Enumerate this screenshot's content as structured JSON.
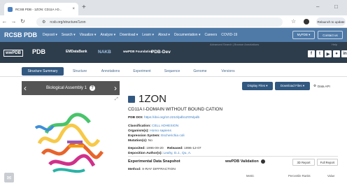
{
  "browser": {
    "tab_title": "RCSB PDB - 1ZON: CD11A I-D...",
    "tab_close": "×",
    "new_tab": "+",
    "url": "rcsb.org/structure/1zon",
    "update_label": "Relaunch to update",
    "minimize": "–",
    "maximize": "□"
  },
  "rcsb_nav": {
    "brand": "RCSB PDB",
    "items": [
      "Deposit ▾",
      "Search ▾",
      "Visualize ▾",
      "Analyze ▾",
      "Download ▾",
      "Learn ▾",
      "About ▾",
      "Documentation ▾",
      "Careers",
      "COVID-19"
    ],
    "mypdb": "MyPDB ▾",
    "contact": "Contact us"
  },
  "partners": {
    "hint": "Advanced Search | Browse Annotations",
    "help": "Help",
    "logos": [
      "wwPDB",
      "PDB",
      "EMDataBank",
      "NAKB",
      "wwPDB Foundation",
      "PDB-Dev"
    ]
  },
  "tabs": [
    "Structure Summary",
    "Structure",
    "Annotations",
    "Experiment",
    "Sequence",
    "Genome",
    "Versions"
  ],
  "viewer": {
    "assembly_label": "Biological Assembly 1",
    "help_glyph": "?",
    "prev": "‹",
    "next": "›",
    "expand": "⤢"
  },
  "actions": {
    "display_files": "Display Files ▾",
    "download_files": "Download Files ▾",
    "data_api": "Data API"
  },
  "entry": {
    "id": "1ZON",
    "title": "CD11A I-DOMAIN WITHOUT BOUND CATION",
    "doi_label": "PDB DOI:",
    "doi": "https://doi.org/10.2210/pdb1ZON/pdb",
    "classification_label": "Classification:",
    "classification": "CELL ADHESION",
    "organism_label": "Organism(s):",
    "organism": "Homo sapiens",
    "expression_label": "Expression System:",
    "expression": "Escherichia coli",
    "mutation_label": "Mutation(s):",
    "mutation": "No",
    "deposited_label": "Deposited:",
    "deposited": "1996-09-20",
    "released_label": "Released:",
    "released": "1996-12-07",
    "authors_label": "Deposition Author(s):",
    "authors": "Leahy, D.J., Qu, A."
  },
  "experiment": {
    "heading": "Experimental Data Snapshot",
    "method_label": "Method:",
    "method": "X-RAY DIFFRACTION"
  },
  "validation": {
    "heading": "wwPDB Validation",
    "report_3d": "3D Report",
    "full_report": "Full Report",
    "col_metric": "Metric",
    "col_rank": "Percentile Ranks",
    "col_value": "Value"
  },
  "colors": {
    "nav_blue": "#4f7aa8",
    "dark_band": "#2e3d4c",
    "button_blue": "#325880",
    "link": "#3a7cc0"
  }
}
